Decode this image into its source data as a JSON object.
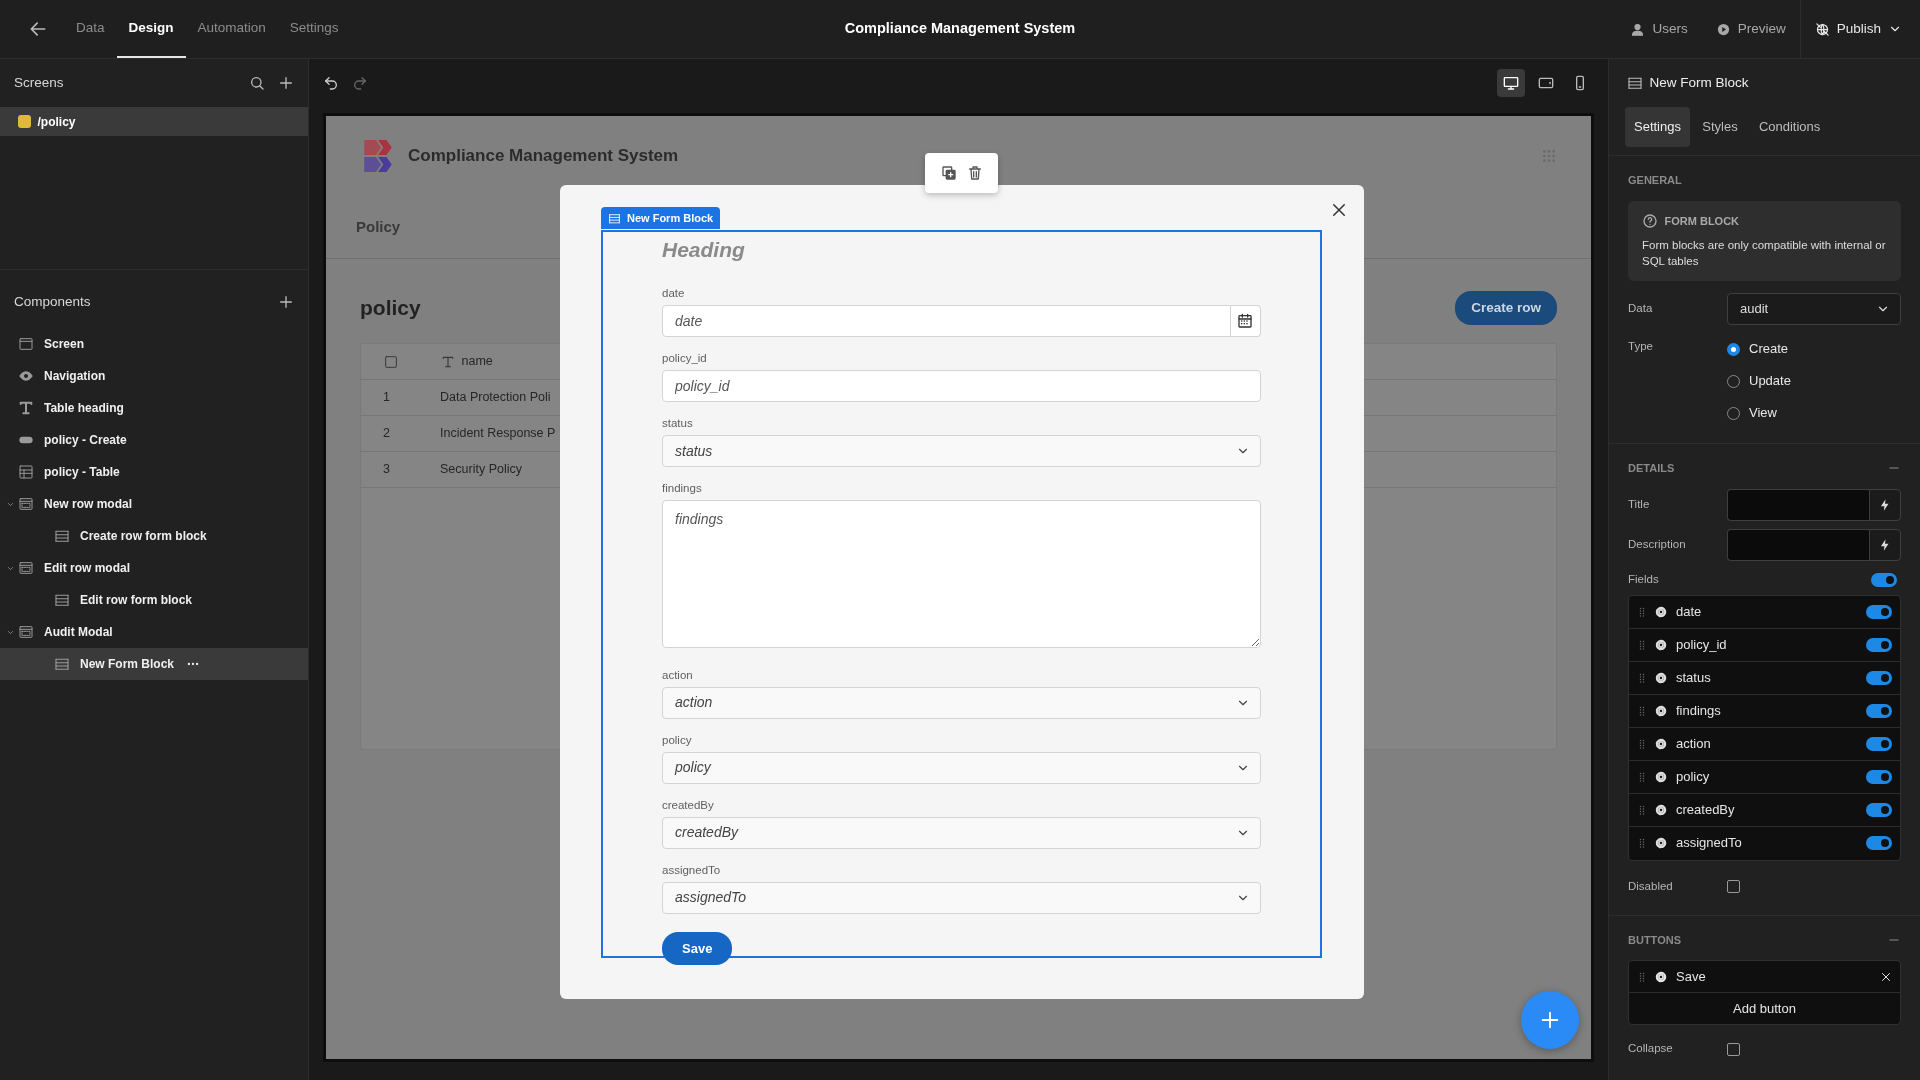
{
  "topbar": {
    "tabs": [
      {
        "label": "Data",
        "selected": false
      },
      {
        "label": "Design",
        "selected": true
      },
      {
        "label": "Automation",
        "selected": false
      },
      {
        "label": "Settings",
        "selected": false
      }
    ],
    "title": "Compliance Management System",
    "actions": [
      {
        "kind": "users",
        "label": "Users"
      },
      {
        "kind": "preview",
        "label": "Preview"
      },
      {
        "kind": "publish",
        "label": "Publish"
      }
    ]
  },
  "screens": {
    "title": "Screens",
    "items": [
      {
        "label": "/policy",
        "color": "#e0b83a",
        "selected": true
      }
    ]
  },
  "components": {
    "title": "Components",
    "items": [
      {
        "kind": "screen",
        "label": "Screen",
        "selected": false
      },
      {
        "kind": "navigation",
        "label": "Navigation",
        "selected": false
      },
      {
        "kind": "text",
        "label": "Table heading",
        "selected": false
      },
      {
        "kind": "button",
        "label": "policy - Create",
        "selected": false
      },
      {
        "kind": "table",
        "label": "policy - Table",
        "selected": false
      },
      {
        "kind": "modal",
        "label": "New row modal",
        "selected": false,
        "expanded": true,
        "children": [
          {
            "kind": "form",
            "label": "Create row form block",
            "selected": false
          }
        ]
      },
      {
        "kind": "modal",
        "label": "Edit row modal",
        "selected": false,
        "expanded": true,
        "children": [
          {
            "kind": "form",
            "label": "Edit row form block",
            "selected": false
          }
        ]
      },
      {
        "kind": "modal",
        "label": "Audit Modal",
        "selected": false,
        "expanded": true,
        "children": [
          {
            "kind": "form",
            "label": "New Form Block",
            "selected": true
          }
        ]
      }
    ]
  },
  "toolbar": {
    "devices": [
      {
        "kind": "desktop",
        "selected": true
      },
      {
        "kind": "tablet",
        "selected": false
      },
      {
        "kind": "mobile",
        "selected": false
      }
    ]
  },
  "canvas": {
    "app_title": "Compliance Management System",
    "nav_link": "Policy",
    "heading": "policy",
    "create_button": "Create row",
    "table": {
      "columns": [
        "name"
      ],
      "rows": [
        {
          "number": "1",
          "name": "Data Protection Poli"
        },
        {
          "number": "2",
          "name": "Incident Response P"
        },
        {
          "number": "3",
          "name": "Security Policy"
        }
      ]
    }
  },
  "modal": {
    "block_tag": "New Form Block",
    "heading": "Heading",
    "fields": [
      {
        "label": "date",
        "kind": "date",
        "placeholder": "date"
      },
      {
        "label": "policy_id",
        "kind": "text",
        "placeholder": "policy_id"
      },
      {
        "label": "status",
        "kind": "select",
        "placeholder": "status"
      },
      {
        "label": "findings",
        "kind": "textarea",
        "placeholder": "findings"
      },
      {
        "label": "action",
        "kind": "select",
        "placeholder": "action"
      },
      {
        "label": "policy",
        "kind": "select",
        "placeholder": "policy"
      },
      {
        "label": "createdBy",
        "kind": "select",
        "placeholder": "createdBy"
      },
      {
        "label": "assignedTo",
        "kind": "select",
        "placeholder": "assignedTo"
      }
    ],
    "submit": "Save"
  },
  "settings": {
    "title": "New Form Block",
    "tabs": [
      {
        "label": "Settings",
        "selected": true
      },
      {
        "label": "Styles",
        "selected": false
      },
      {
        "label": "Conditions",
        "selected": false
      }
    ],
    "general": {
      "title": "GENERAL",
      "info_title": "FORM BLOCK",
      "info_text": "Form blocks are only compatible with internal or SQL tables",
      "data_label": "Data",
      "data_value": "audit",
      "type_label": "Type",
      "types": [
        {
          "label": "Create",
          "selected": true
        },
        {
          "label": "Update",
          "selected": false
        },
        {
          "label": "View",
          "selected": false
        }
      ]
    },
    "details": {
      "title": "DETAILS",
      "title_label": "Title",
      "description_label": "Description",
      "fields_label": "Fields",
      "fields_on": true,
      "fields": [
        {
          "label": "date",
          "on": true
        },
        {
          "label": "policy_id",
          "on": true
        },
        {
          "label": "status",
          "on": true
        },
        {
          "label": "findings",
          "on": true
        },
        {
          "label": "action",
          "on": true
        },
        {
          "label": "policy",
          "on": true
        },
        {
          "label": "createdBy",
          "on": true
        },
        {
          "label": "assignedTo",
          "on": true
        }
      ],
      "disabled_label": "Disabled",
      "disabled": false
    },
    "buttons": {
      "title": "BUTTONS",
      "items": [
        "Save"
      ],
      "add_label": "Add button",
      "collapse_label": "Collapse",
      "collapse": false
    }
  }
}
